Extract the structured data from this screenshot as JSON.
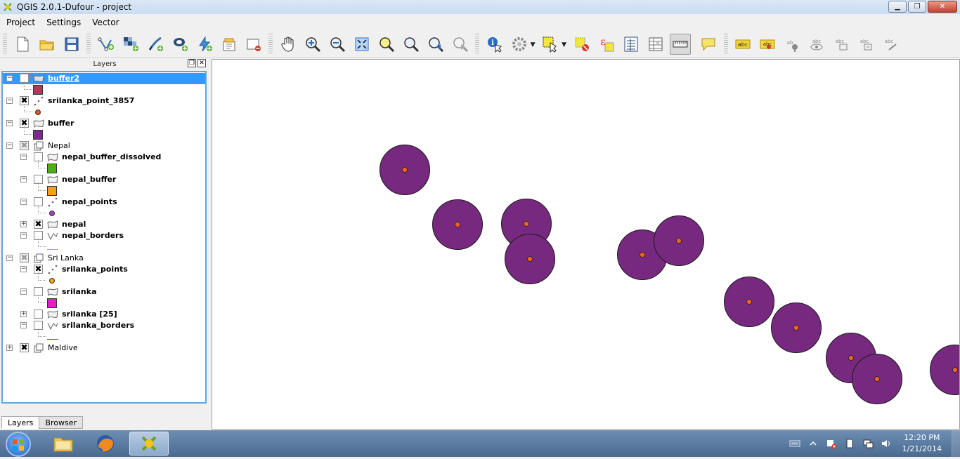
{
  "window": {
    "title": "QGIS 2.0.1-Dufour - project"
  },
  "menubar": {
    "items": [
      "Project",
      "Settings",
      "Vector"
    ]
  },
  "toolbar": {
    "icons": [
      "new-project-icon",
      "open-project-icon",
      "save-project-icon",
      "add-vector-layer-icon",
      "add-raster-layer-icon",
      "add-delimited-text-icon",
      "add-spatialite-icon",
      "add-wms-icon",
      "new-shapefile-icon",
      "remove-layer-icon",
      "pan-icon",
      "zoom-in-icon",
      "zoom-out-icon",
      "zoom-full-icon",
      "zoom-to-selection-icon",
      "zoom-to-layer-icon",
      "zoom-last-icon",
      "zoom-next-icon",
      "identify-icon",
      "run-action-icon",
      "select-features-icon",
      "deselect-icon",
      "select-by-expression-icon",
      "expression-icon",
      "attribute-table-icon",
      "field-calculator-icon",
      "measure-icon",
      "map-tips-icon",
      "label-tool-icon",
      "label-highlight-icon",
      "label-pin-icon",
      "label-show-hide-icon",
      "label-move-icon",
      "label-rotate-icon",
      "label-change-icon"
    ]
  },
  "layers_panel": {
    "title": "Layers",
    "tabs": [
      "Layers",
      "Browser"
    ],
    "active_tab": "Layers",
    "layers": [
      {
        "name": "buffer2",
        "kind": "polygon",
        "checked": false,
        "selected": true,
        "level": 0,
        "expanded": true,
        "symbol_color": "#b5365a",
        "symbol": "square"
      },
      {
        "name": "srilanka_point_3857",
        "kind": "point",
        "checked": true,
        "level": 0,
        "expanded": true,
        "symbol_color": "#e8531a",
        "symbol": "dot"
      },
      {
        "name": "buffer",
        "kind": "polygon",
        "checked": true,
        "level": 0,
        "expanded": true,
        "symbol_color": "#7a2a8c",
        "symbol": "square"
      },
      {
        "name": "Nepal",
        "kind": "group",
        "checked": "partial",
        "level": 0,
        "expanded": true
      },
      {
        "name": "nepal_buffer_dissolved",
        "kind": "polygon",
        "checked": false,
        "level": 1,
        "expanded": true,
        "symbol_color": "#4caf1a",
        "symbol": "square"
      },
      {
        "name": "nepal_buffer",
        "kind": "polygon",
        "checked": false,
        "level": 1,
        "expanded": true,
        "symbol_color": "#f2a50f",
        "symbol": "square"
      },
      {
        "name": "nepal_points",
        "kind": "point",
        "checked": false,
        "level": 1,
        "expanded": true,
        "symbol_color": "#a63bc9",
        "symbol": "dot"
      },
      {
        "name": "nepal",
        "kind": "polygon",
        "checked": true,
        "level": 1,
        "expanded": false
      },
      {
        "name": "nepal_borders",
        "kind": "line",
        "checked": false,
        "level": 1,
        "expanded": true,
        "symbol_color": "#c0b070",
        "symbol": "line"
      },
      {
        "name": "Sri Lanka",
        "kind": "group",
        "checked": "partial",
        "level": 0,
        "expanded": true
      },
      {
        "name": "srilanka_points",
        "kind": "point",
        "checked": true,
        "level": 1,
        "expanded": true,
        "symbol_color": "#f2a50f",
        "symbol": "dot"
      },
      {
        "name": "srilanka",
        "kind": "polygon",
        "checked": false,
        "level": 1,
        "expanded": true,
        "symbol_color": "#e61acb",
        "symbol": "square"
      },
      {
        "name": "srilanka [25]",
        "kind": "polygon",
        "checked": false,
        "level": 1,
        "expanded": false
      },
      {
        "name": "srilanka_borders",
        "kind": "line",
        "checked": false,
        "level": 1,
        "expanded": true,
        "symbol_color": "#7a4a9a",
        "symbol": "line"
      },
      {
        "name": "Maldive",
        "kind": "group",
        "checked": true,
        "level": 0,
        "expanded": false
      }
    ]
  },
  "map": {
    "buffer_fill": "#76297f",
    "point_color": "#f5641a",
    "features": [
      {
        "id": 1
      },
      {
        "id": 2
      },
      {
        "id": 3
      },
      {
        "id": 4
      },
      {
        "id": 5
      },
      {
        "id": 6
      },
      {
        "id": 7
      },
      {
        "id": 8
      },
      {
        "id": 9
      },
      {
        "id": 10
      },
      {
        "id": 11
      }
    ]
  },
  "taskbar": {
    "apps": [
      "windows-explorer-icon",
      "firefox-icon",
      "qgis-icon"
    ],
    "active_app": "qgis-icon",
    "time": "12:20 PM",
    "date": "1/21/2014"
  }
}
